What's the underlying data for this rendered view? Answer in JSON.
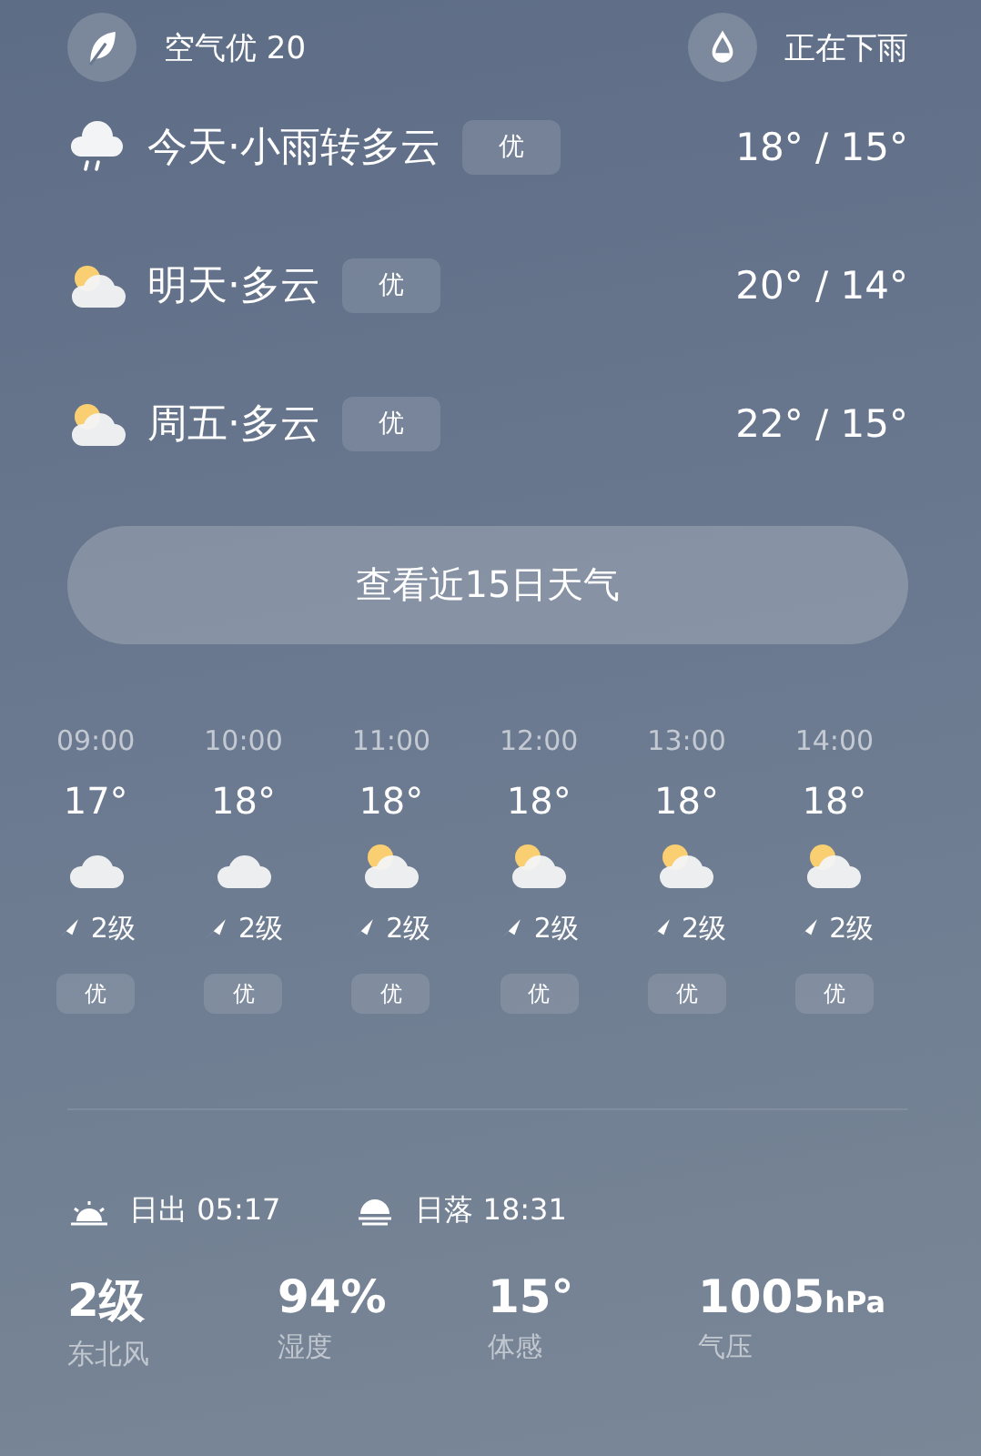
{
  "top_bar": {
    "air": {
      "label": "空气优 20"
    },
    "rain": {
      "label": "正在下雨"
    }
  },
  "daily": [
    {
      "kind": "rain",
      "label": "今天·小雨转多云",
      "aqi": "优",
      "temps": "18° / 15°"
    },
    {
      "kind": "partly",
      "label": "明天·多云",
      "aqi": "优",
      "temps": "20° / 14°"
    },
    {
      "kind": "partly",
      "label": "周五·多云",
      "aqi": "优",
      "temps": "22° / 15°"
    }
  ],
  "forecast_button": "查看近15日天气",
  "hourly": [
    {
      "time": "09:00",
      "temp": "17°",
      "kind": "cloudy",
      "wind": "2级",
      "aqi": "优"
    },
    {
      "time": "10:00",
      "temp": "18°",
      "kind": "cloudy",
      "wind": "2级",
      "aqi": "优"
    },
    {
      "time": "11:00",
      "temp": "18°",
      "kind": "partly",
      "wind": "2级",
      "aqi": "优"
    },
    {
      "time": "12:00",
      "temp": "18°",
      "kind": "partly",
      "wind": "2级",
      "aqi": "优"
    },
    {
      "time": "13:00",
      "temp": "18°",
      "kind": "partly",
      "wind": "2级",
      "aqi": "优"
    },
    {
      "time": "14:00",
      "temp": "18°",
      "kind": "partly",
      "wind": "2级",
      "aqi": "优"
    }
  ],
  "sun": {
    "sunrise": "日出 05:17",
    "sunset": "日落 18:31"
  },
  "stats": [
    {
      "value": "2级",
      "label": "东北风"
    },
    {
      "value": "94%",
      "label": "湿度"
    },
    {
      "value": "15°",
      "label": "体感"
    },
    {
      "value": "1005",
      "unit": "hPa",
      "label": "气压"
    }
  ]
}
